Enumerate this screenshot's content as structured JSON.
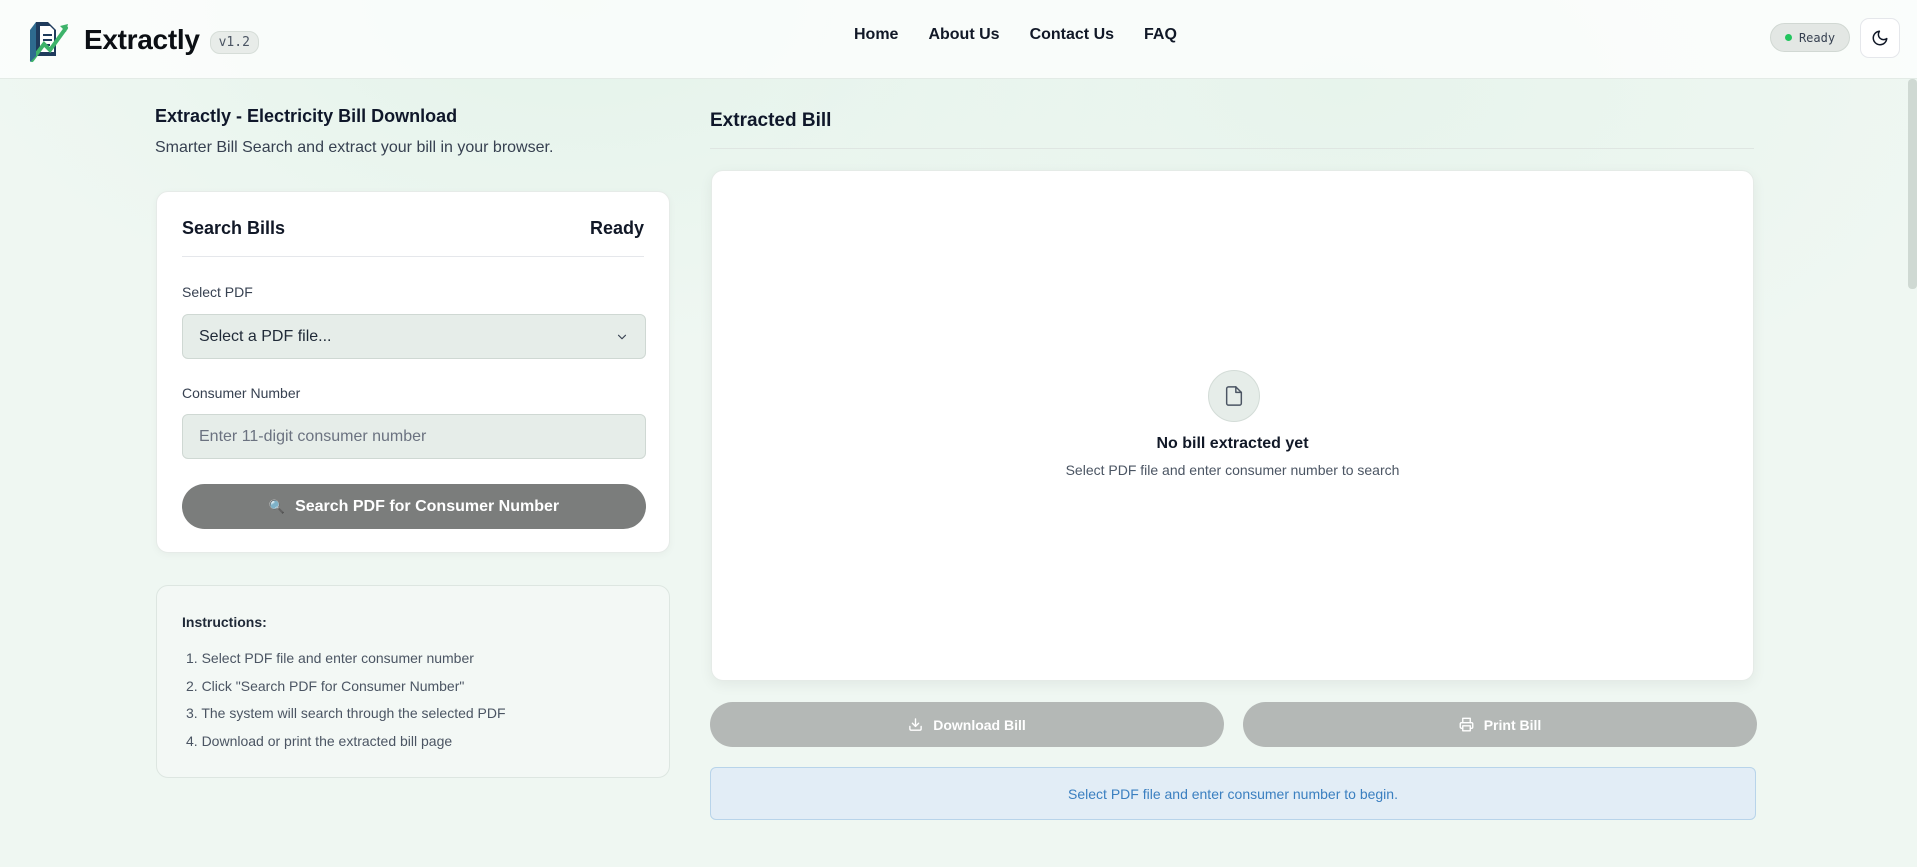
{
  "app": {
    "name": "Extractly",
    "version": "v1.2"
  },
  "nav": {
    "items": [
      "Home",
      "About Us",
      "Contact Us",
      "FAQ"
    ]
  },
  "header_status": "Ready",
  "page": {
    "title": "Extractly - Electricity Bill Download",
    "subtitle": "Smarter Bill Search and extract your bill in your browser."
  },
  "search_card": {
    "title": "Search Bills",
    "status": "Ready",
    "pdf_label": "Select PDF",
    "pdf_select_value": "Select a PDF file...",
    "consumer_label": "Consumer Number",
    "consumer_placeholder": "Enter 11-digit consumer number",
    "search_button": "Search PDF for Consumer Number",
    "search_icon": "🔍"
  },
  "instructions": {
    "title": "Instructions:",
    "steps": [
      "1. Select PDF file and enter consumer number",
      "2. Click \"Search PDF for Consumer Number\"",
      "3. The system will search through the selected PDF",
      "4. Download or print the extracted bill page"
    ]
  },
  "extracted": {
    "title": "Extracted Bill",
    "empty_title": "No bill extracted yet",
    "empty_subtitle": "Select PDF file and enter consumer number to search",
    "empty_icon": "file-icon"
  },
  "actions": {
    "download": "Download Bill",
    "print": "Print Bill"
  },
  "notice": "Select PDF file and enter consumer number to begin.",
  "colors": {
    "status_dot": "#22c55e",
    "search_button": "#7b7d7c",
    "action_buttons": "#b4b8b6",
    "notice_text": "#3a7fc0",
    "notice_bg": "#e2edf6"
  }
}
